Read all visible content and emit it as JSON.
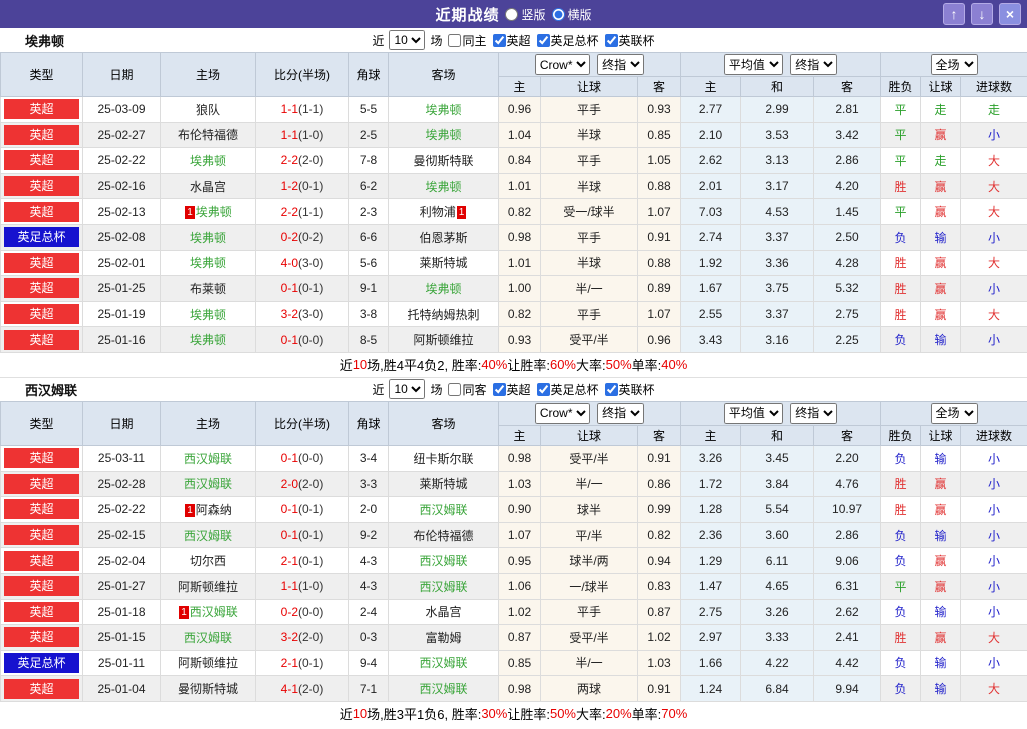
{
  "title_bar": {
    "title": "近期战绩",
    "radio_vertical": "竖版",
    "radio_horizontal": "横版",
    "vertical_checked": false,
    "horizontal_checked": true,
    "up_glyph": "↑",
    "down_glyph": "↓",
    "close_glyph": "×"
  },
  "colors": {
    "titlebar": "#4c4399",
    "league_badge": {
      "英超": "#ee3333",
      "英足总杯": "#1612cf"
    },
    "focal_team": "#3aa53a",
    "score": "#e80000",
    "win": "#e13333",
    "draw": "#2ba02b",
    "loss": "#2323cb"
  },
  "filter": {
    "near": "近",
    "games_value": "10",
    "games_suffix": "场",
    "leagues": [
      "英超",
      "英足总杯",
      "英联杯"
    ],
    "same_checked": false,
    "league_checked": [
      true,
      true,
      true
    ]
  },
  "columns": {
    "type": "类型",
    "date": "日期",
    "home": "主场",
    "score": "比分(半场)",
    "corner": "角球",
    "away": "客场",
    "odds_home": "主",
    "odds_handicap": "让球",
    "odds_away": "客",
    "avg_home": "主",
    "avg_draw": "和",
    "avg_away": "客",
    "result_wl": "胜负",
    "result_handicap": "让球",
    "result_goals": "进球数"
  },
  "header_selects": {
    "bookmaker": "Crow*",
    "final1": "终指",
    "average": "平均值",
    "final2": "终指",
    "scope": "全场"
  },
  "sections": [
    {
      "team": "埃弗顿",
      "same_label": "同主",
      "rows": [
        {
          "type": "英超",
          "date": "25-03-09",
          "home": {
            "pre": false,
            "name": "狼队",
            "post": false,
            "focal": false
          },
          "score": {
            "ft": "1-1",
            "ht": "(1-1)"
          },
          "corner": "5-5",
          "away": {
            "pre": false,
            "name": "埃弗顿",
            "post": false,
            "focal": true
          },
          "odds": [
            "0.96",
            "平手",
            "0.93"
          ],
          "avg": [
            "2.77",
            "2.99",
            "2.81"
          ],
          "result": [
            "平",
            "走",
            "走"
          ]
        },
        {
          "type": "英超",
          "date": "25-02-27",
          "home": {
            "pre": false,
            "name": "布伦特福德",
            "post": false,
            "focal": false
          },
          "score": {
            "ft": "1-1",
            "ht": "(1-0)"
          },
          "corner": "2-5",
          "away": {
            "pre": false,
            "name": "埃弗顿",
            "post": false,
            "focal": true
          },
          "odds": [
            "1.04",
            "半球",
            "0.85"
          ],
          "avg": [
            "2.10",
            "3.53",
            "3.42"
          ],
          "result": [
            "平",
            "赢",
            "小"
          ]
        },
        {
          "type": "英超",
          "date": "25-02-22",
          "home": {
            "pre": false,
            "name": "埃弗顿",
            "post": false,
            "focal": true
          },
          "score": {
            "ft": "2-2",
            "ht": "(2-0)"
          },
          "corner": "7-8",
          "away": {
            "pre": false,
            "name": "曼彻斯特联",
            "post": false,
            "focal": false
          },
          "odds": [
            "0.84",
            "平手",
            "1.05"
          ],
          "avg": [
            "2.62",
            "3.13",
            "2.86"
          ],
          "result": [
            "平",
            "走",
            "大"
          ]
        },
        {
          "type": "英超",
          "date": "25-02-16",
          "home": {
            "pre": false,
            "name": "水晶宫",
            "post": false,
            "focal": false
          },
          "score": {
            "ft": "1-2",
            "ht": "(0-1)"
          },
          "corner": "6-2",
          "away": {
            "pre": false,
            "name": "埃弗顿",
            "post": false,
            "focal": true
          },
          "odds": [
            "1.01",
            "半球",
            "0.88"
          ],
          "avg": [
            "2.01",
            "3.17",
            "4.20"
          ],
          "result": [
            "胜",
            "赢",
            "大"
          ]
        },
        {
          "type": "英超",
          "date": "25-02-13",
          "home": {
            "pre": true,
            "name": "埃弗顿",
            "post": false,
            "focal": true
          },
          "score": {
            "ft": "2-2",
            "ht": "(1-1)"
          },
          "corner": "2-3",
          "away": {
            "pre": false,
            "name": "利物浦",
            "post": true,
            "focal": false
          },
          "odds": [
            "0.82",
            "受一/球半",
            "1.07"
          ],
          "avg": [
            "7.03",
            "4.53",
            "1.45"
          ],
          "result": [
            "平",
            "赢",
            "大"
          ]
        },
        {
          "type": "英足总杯",
          "date": "25-02-08",
          "home": {
            "pre": false,
            "name": "埃弗顿",
            "post": false,
            "focal": true
          },
          "score": {
            "ft": "0-2",
            "ht": "(0-2)"
          },
          "corner": "6-6",
          "away": {
            "pre": false,
            "name": "伯恩茅斯",
            "post": false,
            "focal": false
          },
          "odds": [
            "0.98",
            "平手",
            "0.91"
          ],
          "avg": [
            "2.74",
            "3.37",
            "2.50"
          ],
          "result": [
            "负",
            "输",
            "小"
          ]
        },
        {
          "type": "英超",
          "date": "25-02-01",
          "home": {
            "pre": false,
            "name": "埃弗顿",
            "post": false,
            "focal": true
          },
          "score": {
            "ft": "4-0",
            "ht": "(3-0)"
          },
          "corner": "5-6",
          "away": {
            "pre": false,
            "name": "莱斯特城",
            "post": false,
            "focal": false
          },
          "odds": [
            "1.01",
            "半球",
            "0.88"
          ],
          "avg": [
            "1.92",
            "3.36",
            "4.28"
          ],
          "result": [
            "胜",
            "赢",
            "大"
          ]
        },
        {
          "type": "英超",
          "date": "25-01-25",
          "home": {
            "pre": false,
            "name": "布莱顿",
            "post": false,
            "focal": false
          },
          "score": {
            "ft": "0-1",
            "ht": "(0-1)"
          },
          "corner": "9-1",
          "away": {
            "pre": false,
            "name": "埃弗顿",
            "post": false,
            "focal": true
          },
          "odds": [
            "1.00",
            "半/一",
            "0.89"
          ],
          "avg": [
            "1.67",
            "3.75",
            "5.32"
          ],
          "result": [
            "胜",
            "赢",
            "小"
          ]
        },
        {
          "type": "英超",
          "date": "25-01-19",
          "home": {
            "pre": false,
            "name": "埃弗顿",
            "post": false,
            "focal": true
          },
          "score": {
            "ft": "3-2",
            "ht": "(3-0)"
          },
          "corner": "3-8",
          "away": {
            "pre": false,
            "name": "托特纳姆热刺",
            "post": false,
            "focal": false
          },
          "odds": [
            "0.82",
            "平手",
            "1.07"
          ],
          "avg": [
            "2.55",
            "3.37",
            "2.75"
          ],
          "result": [
            "胜",
            "赢",
            "大"
          ]
        },
        {
          "type": "英超",
          "date": "25-01-16",
          "home": {
            "pre": false,
            "name": "埃弗顿",
            "post": false,
            "focal": true
          },
          "score": {
            "ft": "0-1",
            "ht": "(0-0)"
          },
          "corner": "8-5",
          "away": {
            "pre": false,
            "name": "阿斯顿维拉",
            "post": false,
            "focal": false
          },
          "odds": [
            "0.93",
            "受平/半",
            "0.96"
          ],
          "avg": [
            "3.43",
            "3.16",
            "2.25"
          ],
          "result": [
            "负",
            "输",
            "小"
          ]
        }
      ],
      "summary": [
        [
          "近",
          false
        ],
        [
          "10",
          true
        ],
        [
          "场,胜4平4负2, 胜率:",
          false
        ],
        [
          "40%",
          true
        ],
        [
          " 让胜率:",
          false
        ],
        [
          "60%",
          true
        ],
        [
          " 大率:",
          false
        ],
        [
          "50%",
          true
        ],
        [
          " 单率:",
          false
        ],
        [
          "40%",
          true
        ]
      ]
    },
    {
      "team": "西汉姆联",
      "same_label": "同客",
      "rows": [
        {
          "type": "英超",
          "date": "25-03-11",
          "home": {
            "pre": false,
            "name": "西汉姆联",
            "post": false,
            "focal": true
          },
          "score": {
            "ft": "0-1",
            "ht": "(0-0)"
          },
          "corner": "3-4",
          "away": {
            "pre": false,
            "name": "纽卡斯尔联",
            "post": false,
            "focal": false
          },
          "odds": [
            "0.98",
            "受平/半",
            "0.91"
          ],
          "avg": [
            "3.26",
            "3.45",
            "2.20"
          ],
          "result": [
            "负",
            "输",
            "小"
          ]
        },
        {
          "type": "英超",
          "date": "25-02-28",
          "home": {
            "pre": false,
            "name": "西汉姆联",
            "post": false,
            "focal": true
          },
          "score": {
            "ft": "2-0",
            "ht": "(2-0)"
          },
          "corner": "3-3",
          "away": {
            "pre": false,
            "name": "莱斯特城",
            "post": false,
            "focal": false
          },
          "odds": [
            "1.03",
            "半/一",
            "0.86"
          ],
          "avg": [
            "1.72",
            "3.84",
            "4.76"
          ],
          "result": [
            "胜",
            "赢",
            "小"
          ]
        },
        {
          "type": "英超",
          "date": "25-02-22",
          "home": {
            "pre": true,
            "name": "阿森纳",
            "post": false,
            "focal": false
          },
          "score": {
            "ft": "0-1",
            "ht": "(0-1)"
          },
          "corner": "2-0",
          "away": {
            "pre": false,
            "name": "西汉姆联",
            "post": false,
            "focal": true
          },
          "odds": [
            "0.90",
            "球半",
            "0.99"
          ],
          "avg": [
            "1.28",
            "5.54",
            "10.97"
          ],
          "result": [
            "胜",
            "赢",
            "小"
          ]
        },
        {
          "type": "英超",
          "date": "25-02-15",
          "home": {
            "pre": false,
            "name": "西汉姆联",
            "post": false,
            "focal": true
          },
          "score": {
            "ft": "0-1",
            "ht": "(0-1)"
          },
          "corner": "9-2",
          "away": {
            "pre": false,
            "name": "布伦特福德",
            "post": false,
            "focal": false
          },
          "odds": [
            "1.07",
            "平/半",
            "0.82"
          ],
          "avg": [
            "2.36",
            "3.60",
            "2.86"
          ],
          "result": [
            "负",
            "输",
            "小"
          ]
        },
        {
          "type": "英超",
          "date": "25-02-04",
          "home": {
            "pre": false,
            "name": "切尔西",
            "post": false,
            "focal": false
          },
          "score": {
            "ft": "2-1",
            "ht": "(0-1)"
          },
          "corner": "4-3",
          "away": {
            "pre": false,
            "name": "西汉姆联",
            "post": false,
            "focal": true
          },
          "odds": [
            "0.95",
            "球半/两",
            "0.94"
          ],
          "avg": [
            "1.29",
            "6.11",
            "9.06"
          ],
          "result": [
            "负",
            "赢",
            "小"
          ]
        },
        {
          "type": "英超",
          "date": "25-01-27",
          "home": {
            "pre": false,
            "name": "阿斯顿维拉",
            "post": false,
            "focal": false
          },
          "score": {
            "ft": "1-1",
            "ht": "(1-0)"
          },
          "corner": "4-3",
          "away": {
            "pre": false,
            "name": "西汉姆联",
            "post": false,
            "focal": true
          },
          "odds": [
            "1.06",
            "一/球半",
            "0.83"
          ],
          "avg": [
            "1.47",
            "4.65",
            "6.31"
          ],
          "result": [
            "平",
            "赢",
            "小"
          ]
        },
        {
          "type": "英超",
          "date": "25-01-18",
          "home": {
            "pre": true,
            "name": "西汉姆联",
            "post": false,
            "focal": true
          },
          "score": {
            "ft": "0-2",
            "ht": "(0-0)"
          },
          "corner": "2-4",
          "away": {
            "pre": false,
            "name": "水晶宫",
            "post": false,
            "focal": false
          },
          "odds": [
            "1.02",
            "平手",
            "0.87"
          ],
          "avg": [
            "2.75",
            "3.26",
            "2.62"
          ],
          "result": [
            "负",
            "输",
            "小"
          ]
        },
        {
          "type": "英超",
          "date": "25-01-15",
          "home": {
            "pre": false,
            "name": "西汉姆联",
            "post": false,
            "focal": true
          },
          "score": {
            "ft": "3-2",
            "ht": "(2-0)"
          },
          "corner": "0-3",
          "away": {
            "pre": false,
            "name": "富勒姆",
            "post": false,
            "focal": false
          },
          "odds": [
            "0.87",
            "受平/半",
            "1.02"
          ],
          "avg": [
            "2.97",
            "3.33",
            "2.41"
          ],
          "result": [
            "胜",
            "赢",
            "大"
          ]
        },
        {
          "type": "英足总杯",
          "date": "25-01-11",
          "home": {
            "pre": false,
            "name": "阿斯顿维拉",
            "post": false,
            "focal": false
          },
          "score": {
            "ft": "2-1",
            "ht": "(0-1)"
          },
          "corner": "9-4",
          "away": {
            "pre": false,
            "name": "西汉姆联",
            "post": false,
            "focal": true
          },
          "odds": [
            "0.85",
            "半/一",
            "1.03"
          ],
          "avg": [
            "1.66",
            "4.22",
            "4.42"
          ],
          "result": [
            "负",
            "输",
            "小"
          ]
        },
        {
          "type": "英超",
          "date": "25-01-04",
          "home": {
            "pre": false,
            "name": "曼彻斯特城",
            "post": false,
            "focal": false
          },
          "score": {
            "ft": "4-1",
            "ht": "(2-0)"
          },
          "corner": "7-1",
          "away": {
            "pre": false,
            "name": "西汉姆联",
            "post": false,
            "focal": true
          },
          "odds": [
            "0.98",
            "两球",
            "0.91"
          ],
          "avg": [
            "1.24",
            "6.84",
            "9.94"
          ],
          "result": [
            "负",
            "输",
            "大"
          ]
        }
      ],
      "summary": [
        [
          "近",
          false
        ],
        [
          "10",
          true
        ],
        [
          "场,胜3平1负6, 胜率:",
          false
        ],
        [
          "30%",
          true
        ],
        [
          " 让胜率:",
          false
        ],
        [
          "50%",
          true
        ],
        [
          " 大率:",
          false
        ],
        [
          "20%",
          true
        ],
        [
          " 单率:",
          false
        ],
        [
          "70%",
          true
        ]
      ]
    }
  ],
  "red_card_badge": "1"
}
